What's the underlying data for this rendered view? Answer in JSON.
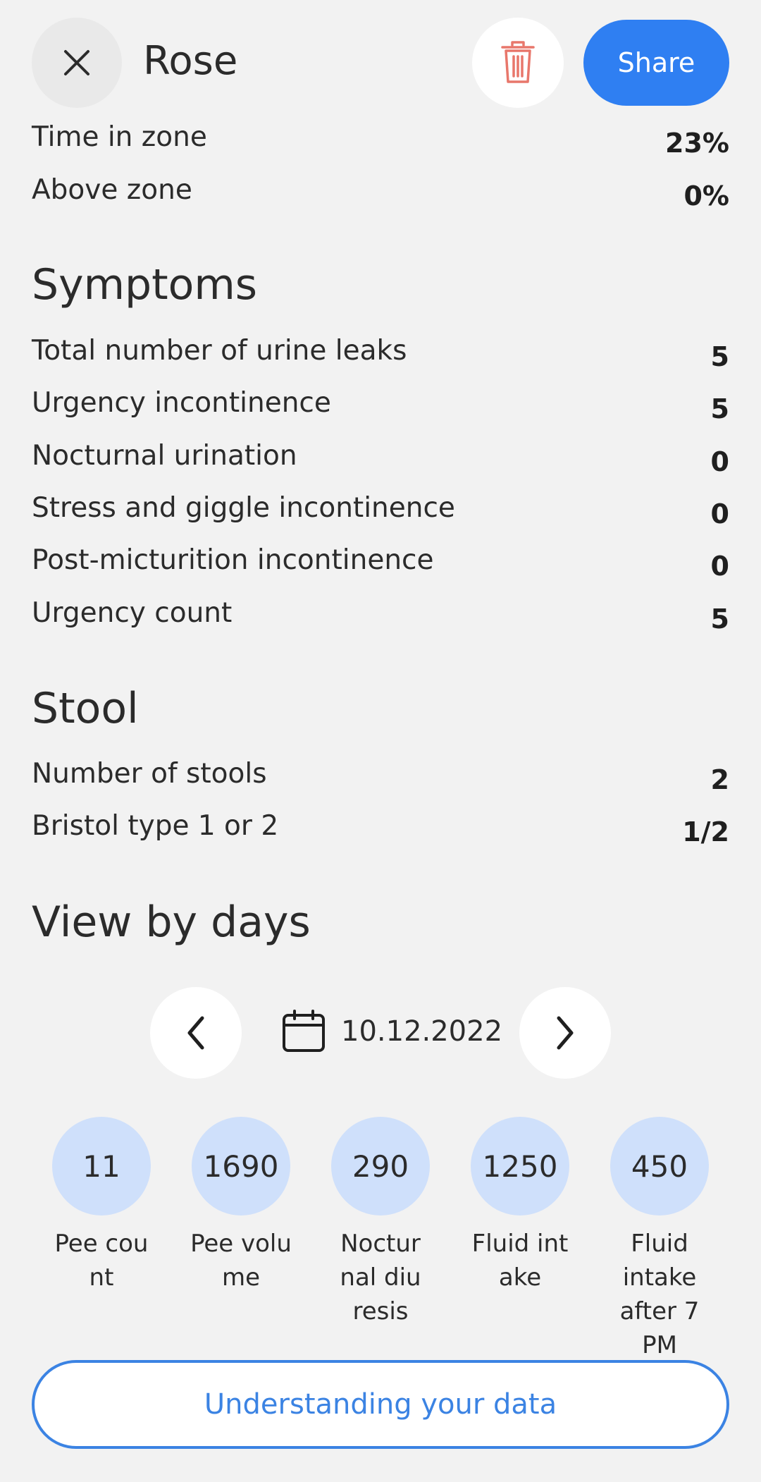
{
  "header": {
    "title": "Rose",
    "share_label": "Share",
    "close_icon": "close-icon",
    "delete_icon": "trash-icon"
  },
  "zone_stats": [
    {
      "label": "Time in zone",
      "value": "23%"
    },
    {
      "label": "Above zone",
      "value": "0%"
    }
  ],
  "symptoms": {
    "title": "Symptoms",
    "rows": [
      {
        "label": "Total number of urine leaks",
        "value": "5"
      },
      {
        "label": "Urgency incontinence",
        "value": "5"
      },
      {
        "label": "Nocturnal urination",
        "value": "0"
      },
      {
        "label": "Stress and giggle incontinence",
        "value": "0"
      },
      {
        "label": "Post-micturition incontinence",
        "value": "0"
      },
      {
        "label": "Urgency count",
        "value": "5"
      }
    ]
  },
  "stool": {
    "title": "Stool",
    "rows": [
      {
        "label": "Number of stools",
        "value": "2"
      },
      {
        "label": "Bristol type 1 or 2",
        "value": "1/2"
      }
    ]
  },
  "view_by_days": {
    "title": "View by days",
    "date": "10.12.2022",
    "metrics": [
      {
        "value": "11",
        "label": "Pee count"
      },
      {
        "value": "1690",
        "label": "Pee volume"
      },
      {
        "value": "290",
        "label": "Nocturnal diuresis"
      },
      {
        "value": "1250",
        "label": "Fluid intake"
      },
      {
        "value": "450",
        "label": "Fluid intake after 7 PM"
      }
    ]
  },
  "footer": {
    "button_label": "Understanding your data"
  },
  "colors": {
    "accent": "#2f7ff2",
    "delete_icon": "#e8776b",
    "metric_circle": "#cfe0fb",
    "background": "#f2f2f2"
  }
}
